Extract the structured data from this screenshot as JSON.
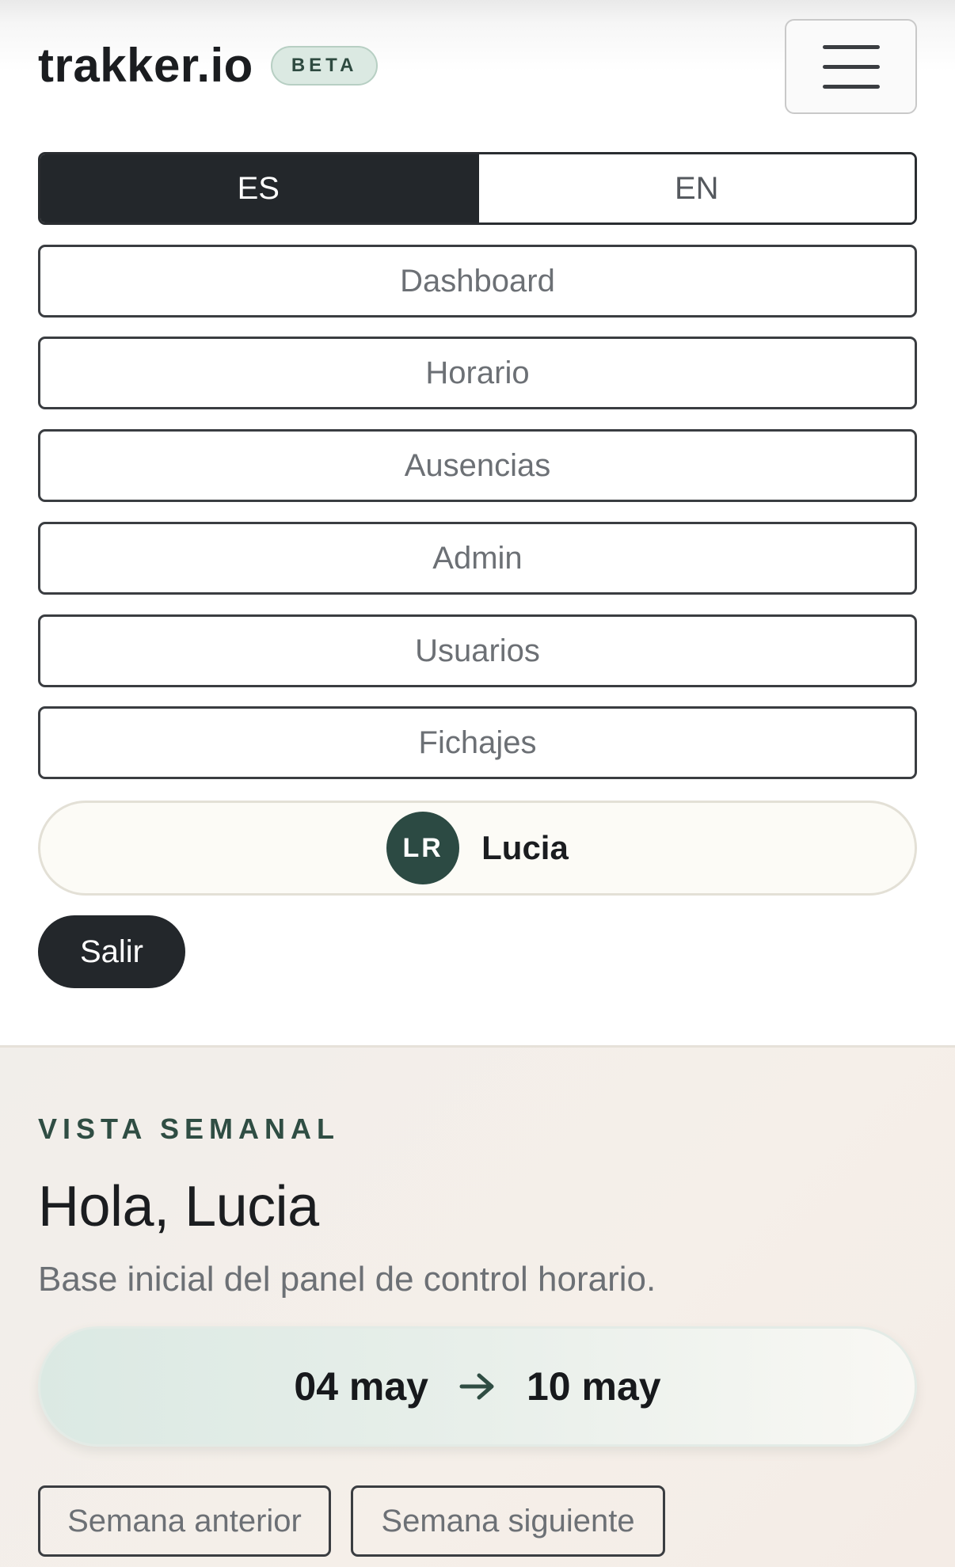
{
  "header": {
    "brand": "trakker.io",
    "badge": "BETA",
    "menu_icon": "hamburger-menu-icon"
  },
  "language": {
    "options": [
      "ES",
      "EN"
    ],
    "selected": "ES"
  },
  "nav": {
    "items": [
      {
        "label": "Dashboard"
      },
      {
        "label": "Horario"
      },
      {
        "label": "Ausencias"
      },
      {
        "label": "Admin"
      },
      {
        "label": "Usuarios"
      },
      {
        "label": "Fichajes"
      }
    ]
  },
  "user": {
    "initials": "LR",
    "name": "Lucia"
  },
  "logout_label": "Salir",
  "main": {
    "eyebrow": "VISTA SEMANAL",
    "greeting": "Hola, Lucia",
    "subtitle": "Base inicial del panel de control horario.",
    "week": {
      "start": "04 may",
      "end": "10 may",
      "arrow_icon": "arrow-right-icon"
    },
    "prev_week_label": "Semana anterior",
    "next_week_label": "Semana siguiente"
  },
  "colors": {
    "dark": "#23272b",
    "accent_green": "#2c4a43",
    "badge_bg": "#dbe9e2"
  }
}
